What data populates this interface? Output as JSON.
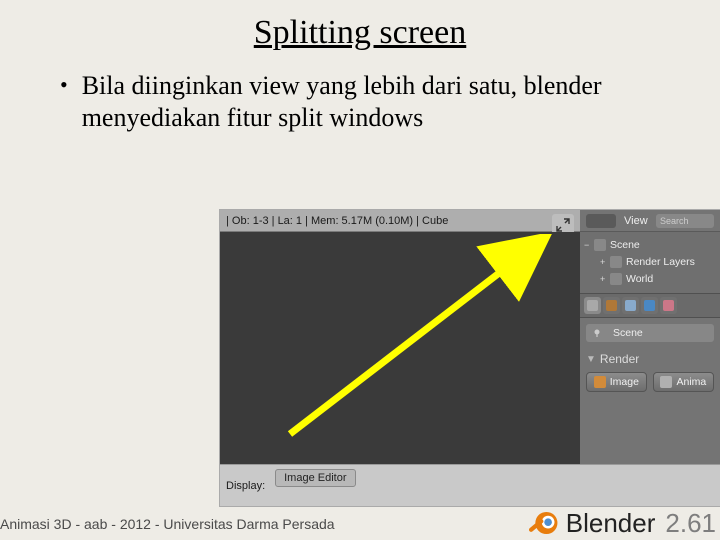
{
  "title": "Splitting screen",
  "bullet": "Bila diinginkan view yang lebih dari satu, blender menyediakan fitur split windows",
  "footer": "Animasi 3D - aab - 2012 - Universitas Darma Persada",
  "shot": {
    "status": "| Ob: 1-3 | La: 1 | Mem: 5.17M (0.10M) | Cube",
    "view_label": "View",
    "search_placeholder": "Search",
    "tree": {
      "scene": "Scene",
      "render_layers": "Render Layers",
      "world": "World"
    },
    "props_field": "Scene",
    "render_section": "Render",
    "image_btn": "Image",
    "anim_btn": "Anima",
    "display_label": "Display:",
    "display_value": "Image Editor"
  },
  "brand": {
    "name": "Blender",
    "version": "2.61"
  },
  "colors": {
    "arrow": "#ffff00",
    "accent_orange": "#e87d0d",
    "accent_blue": "#4f8fcf"
  }
}
